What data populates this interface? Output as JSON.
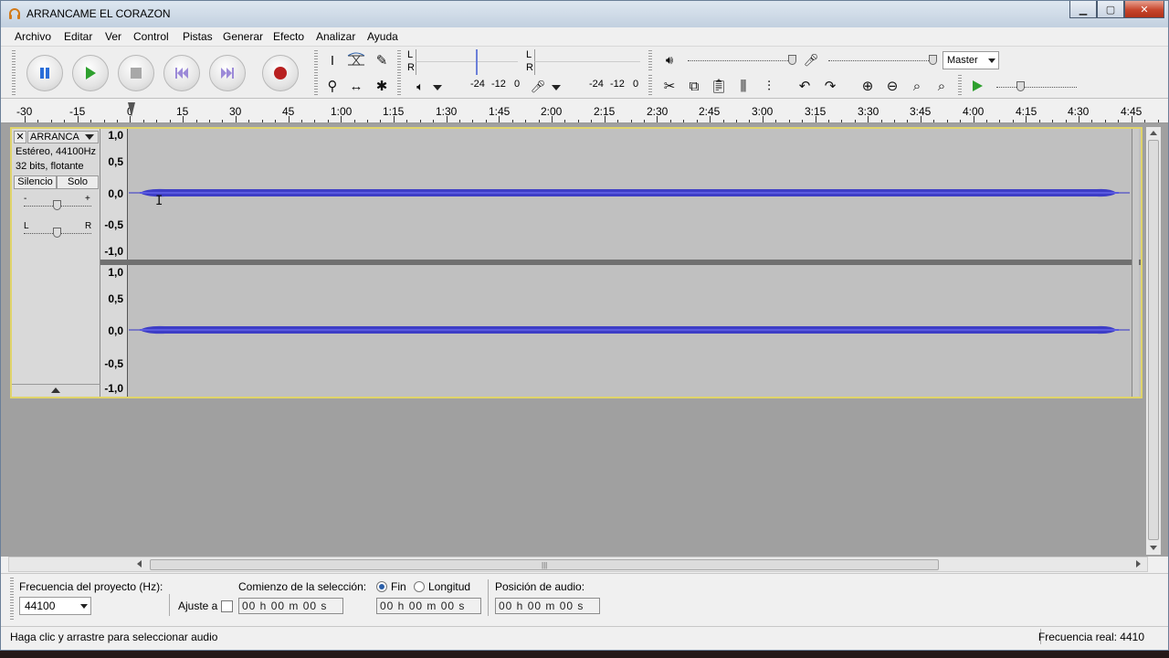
{
  "window": {
    "title": "ARRANCAME EL CORAZON"
  },
  "menu": [
    "Archivo",
    "Editar",
    "Ver",
    "Control",
    "Pistas",
    "Generar",
    "Efecto",
    "Analizar",
    "Ayuda"
  ],
  "meters": {
    "play_l": "L",
    "play_r": "R",
    "rec_l": "L",
    "rec_r": "R",
    "play_scale": [
      "-24",
      "-12",
      "0"
    ],
    "rec_scale": [
      "-24",
      "-12",
      "0"
    ]
  },
  "mixer": {
    "source": "Master"
  },
  "ruler": [
    "-30",
    "-15",
    "0",
    "15",
    "30",
    "45",
    "1:00",
    "1:15",
    "1:30",
    "1:45",
    "2:00",
    "2:15",
    "2:30",
    "2:45",
    "3:00",
    "3:15",
    "3:30",
    "3:45",
    "4:00",
    "4:15",
    "4:30",
    "4:45"
  ],
  "track": {
    "name": "ARRANCA",
    "info1": "Estéreo, 44100Hz",
    "info2": "32 bits, flotante",
    "mute": "Silencio",
    "solo": "Solo",
    "gain_minus": "-",
    "gain_plus": "+",
    "pan_l": "L",
    "pan_r": "R",
    "scale": [
      "1,0",
      "0,5",
      "0,0",
      "-0,5",
      "-1,0"
    ]
  },
  "selection": {
    "rate_label": "Frecuencia del proyecto (Hz):",
    "rate_value": "44100",
    "snap_label": "Ajuste a",
    "start_label": "Comienzo de la selección:",
    "end_label": "Fin",
    "length_label": "Longitud",
    "pos_label": "Posición de audio:",
    "time_value": "00 h 00 m 00 s"
  },
  "status": {
    "hint": "Haga clic y arrastre para seleccionar audio",
    "rate": "Frecuencia real: 4410"
  }
}
